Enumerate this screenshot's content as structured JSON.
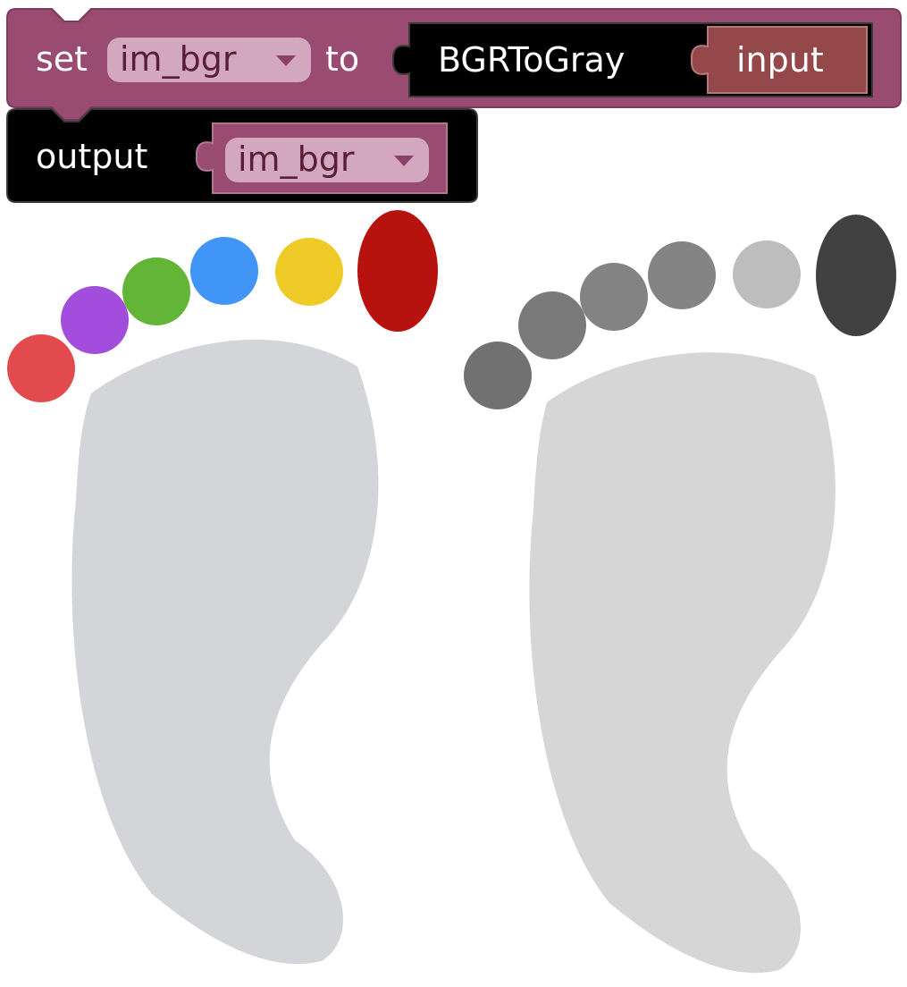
{
  "blocks": {
    "set_block": {
      "set_label": "set",
      "variable": "im_bgr",
      "to_label": "to",
      "color": "#9a4b72"
    },
    "function_block": {
      "name": "BGRToGray",
      "color": "#000000"
    },
    "input_block": {
      "label": "input",
      "color": "#944849"
    },
    "output_block": {
      "label": "output",
      "variable": "im_bgr",
      "color": "#000000"
    },
    "variable_chip_color": "#d3a8bf"
  },
  "images": {
    "original": {
      "foot_color": "#d4d5d9",
      "toe_colors": [
        "#e34a4d",
        "#a24ddc",
        "#62b537",
        "#4195f7",
        "#f0ca26",
        "#b8120f"
      ]
    },
    "grayscale": {
      "foot_color": "#d6d6d6",
      "toe_colors": [
        "#717171",
        "#7a7a7a",
        "#838383",
        "#848484",
        "#bdbdbd",
        "#414141"
      ]
    }
  }
}
